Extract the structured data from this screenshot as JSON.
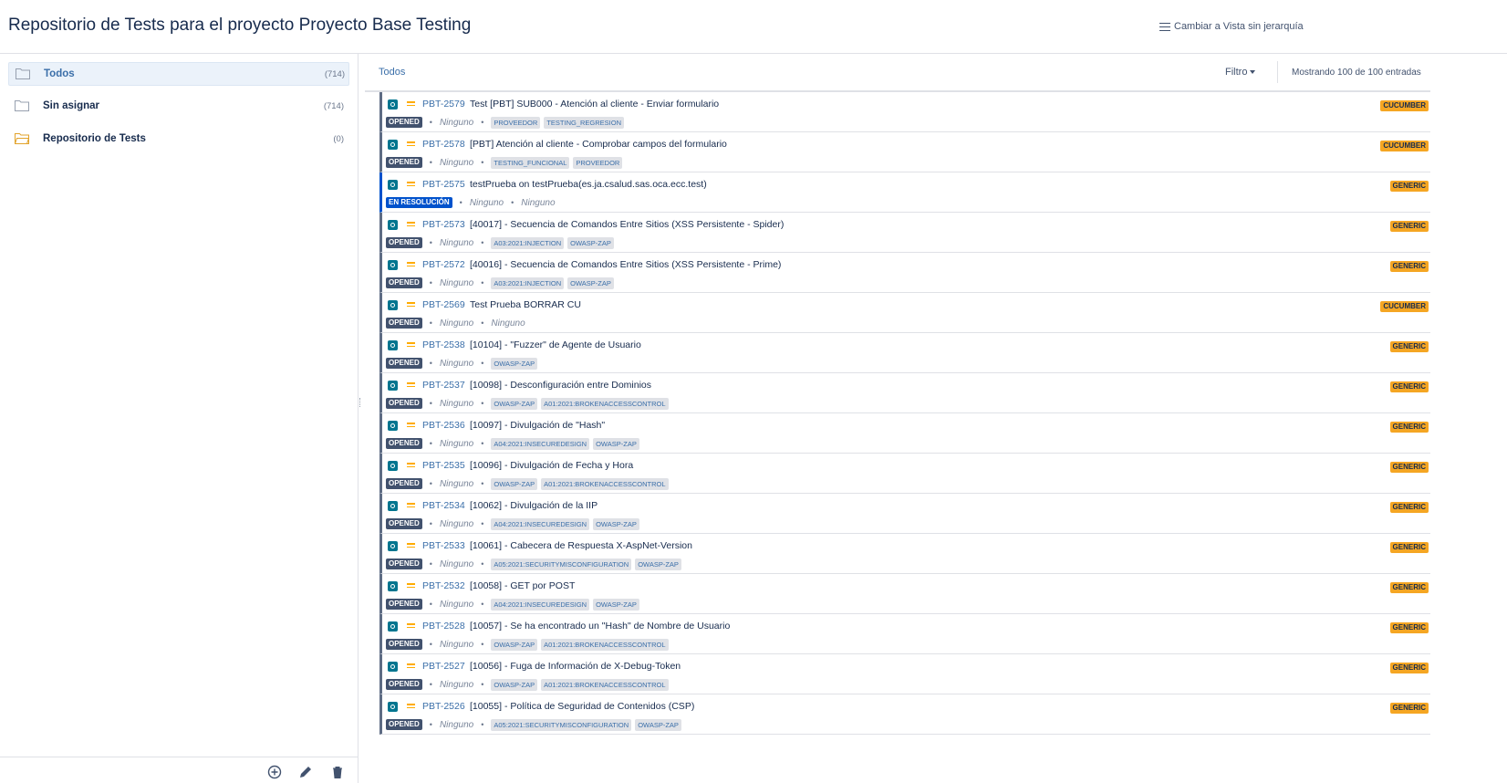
{
  "header": {
    "title": "Repositorio de Tests para el proyecto Proyecto Base Testing",
    "view_toggle": "Cambiar a Vista sin jerarquía"
  },
  "sidebar": {
    "folders": [
      {
        "label": "Todos",
        "count": "(714)",
        "icon": "folder-outline-icon"
      },
      {
        "label": "Sin asignar",
        "count": "(714)",
        "icon": "folder-outline-icon"
      },
      {
        "label": "Repositorio de Tests",
        "count": "(0)",
        "icon": "folder-yellow-icon"
      }
    ],
    "footer_tools": [
      "add-circle-icon",
      "pencil-icon",
      "trash-icon"
    ]
  },
  "toolbar": {
    "breadcrumb": "Todos",
    "filter_label": "Filtro",
    "entries": "Mostrando 100 de 100 entradas"
  },
  "colors": {
    "accent": "#3b6fa9",
    "status_opened": "#42526e",
    "status_resolving": "#0052cc",
    "test_type": "#f5a623",
    "issue_icon": "#00758f",
    "priority": "#ffab00"
  },
  "rows": [
    {
      "key": "PBT-2579",
      "summary": "Test [PBT] SUB000 - Atención al cliente - Enviar formulario",
      "status": "OPENED",
      "meta": [
        "Ninguno"
      ],
      "labels": [
        "PROVEEDOR",
        "TESTING_REGRESION"
      ],
      "type": "CUCUMBER"
    },
    {
      "key": "PBT-2578",
      "summary": "[PBT] Atención al cliente - Comprobar campos del formulario",
      "status": "OPENED",
      "meta": [
        "Ninguno"
      ],
      "labels": [
        "TESTING_FUNCIONAL",
        "PROVEEDOR"
      ],
      "type": "CUCUMBER"
    },
    {
      "key": "PBT-2575",
      "summary": "testPrueba on testPrueba(es.ja.csalud.sas.oca.ecc.test)",
      "status": "EN RESOLUCIÓN",
      "meta": [
        "Ninguno",
        "Ninguno"
      ],
      "labels": [],
      "type": "GENERIC"
    },
    {
      "key": "PBT-2573",
      "summary": "[40017] - Secuencia de Comandos Entre Sitios (XSS Persistente - Spider)",
      "status": "OPENED",
      "meta": [
        "Ninguno"
      ],
      "labels": [
        "A03:2021:INJECTION",
        "OWASP-ZAP"
      ],
      "type": "GENERIC"
    },
    {
      "key": "PBT-2572",
      "summary": "[40016] - Secuencia de Comandos Entre Sitios (XSS Persistente - Prime)",
      "status": "OPENED",
      "meta": [
        "Ninguno"
      ],
      "labels": [
        "A03:2021:INJECTION",
        "OWASP-ZAP"
      ],
      "type": "GENERIC"
    },
    {
      "key": "PBT-2569",
      "summary": "Test Prueba BORRAR CU",
      "status": "OPENED",
      "meta": [
        "Ninguno",
        "Ninguno"
      ],
      "labels": [],
      "type": "CUCUMBER"
    },
    {
      "key": "PBT-2538",
      "summary": "[10104] - \"Fuzzer\" de Agente de Usuario",
      "status": "OPENED",
      "meta": [
        "Ninguno"
      ],
      "labels": [
        "OWASP-ZAP"
      ],
      "type": "GENERIC"
    },
    {
      "key": "PBT-2537",
      "summary": "[10098] - Desconfiguración entre Dominios",
      "status": "OPENED",
      "meta": [
        "Ninguno"
      ],
      "labels": [
        "OWASP-ZAP",
        "A01:2021:BROKENACCESSCONTROL"
      ],
      "type": "GENERIC"
    },
    {
      "key": "PBT-2536",
      "summary": "[10097] - Divulgación de \"Hash\"",
      "status": "OPENED",
      "meta": [
        "Ninguno"
      ],
      "labels": [
        "A04:2021:INSECUREDESIGN",
        "OWASP-ZAP"
      ],
      "type": "GENERIC"
    },
    {
      "key": "PBT-2535",
      "summary": "[10096] - Divulgación de Fecha y Hora",
      "status": "OPENED",
      "meta": [
        "Ninguno"
      ],
      "labels": [
        "OWASP-ZAP",
        "A01:2021:BROKENACCESSCONTROL"
      ],
      "type": "GENERIC"
    },
    {
      "key": "PBT-2534",
      "summary": "[10062] - Divulgación de la IIP",
      "status": "OPENED",
      "meta": [
        "Ninguno"
      ],
      "labels": [
        "A04:2021:INSECUREDESIGN",
        "OWASP-ZAP"
      ],
      "type": "GENERIC"
    },
    {
      "key": "PBT-2533",
      "summary": "[10061] - Cabecera de Respuesta X-AspNet-Version",
      "status": "OPENED",
      "meta": [
        "Ninguno"
      ],
      "labels": [
        "A05:2021:SECURITYMISCONFIGURATION",
        "OWASP-ZAP"
      ],
      "type": "GENERIC"
    },
    {
      "key": "PBT-2532",
      "summary": "[10058] - GET por POST",
      "status": "OPENED",
      "meta": [
        "Ninguno"
      ],
      "labels": [
        "A04:2021:INSECUREDESIGN",
        "OWASP-ZAP"
      ],
      "type": "GENERIC"
    },
    {
      "key": "PBT-2528",
      "summary": "[10057] - Se ha encontrado un \"Hash\" de Nombre de Usuario",
      "status": "OPENED",
      "meta": [
        "Ninguno"
      ],
      "labels": [
        "OWASP-ZAP",
        "A01:2021:BROKENACCESSCONTROL"
      ],
      "type": "GENERIC"
    },
    {
      "key": "PBT-2527",
      "summary": "[10056] - Fuga de Información de X-Debug-Token",
      "status": "OPENED",
      "meta": [
        "Ninguno"
      ],
      "labels": [
        "OWASP-ZAP",
        "A01:2021:BROKENACCESSCONTROL"
      ],
      "type": "GENERIC"
    },
    {
      "key": "PBT-2526",
      "summary": "[10055] - Política de Seguridad de Contenidos (CSP)",
      "status": "OPENED",
      "meta": [
        "Ninguno"
      ],
      "labels": [
        "A05:2021:SECURITYMISCONFIGURATION",
        "OWASP-ZAP"
      ],
      "type": "GENERIC"
    }
  ]
}
